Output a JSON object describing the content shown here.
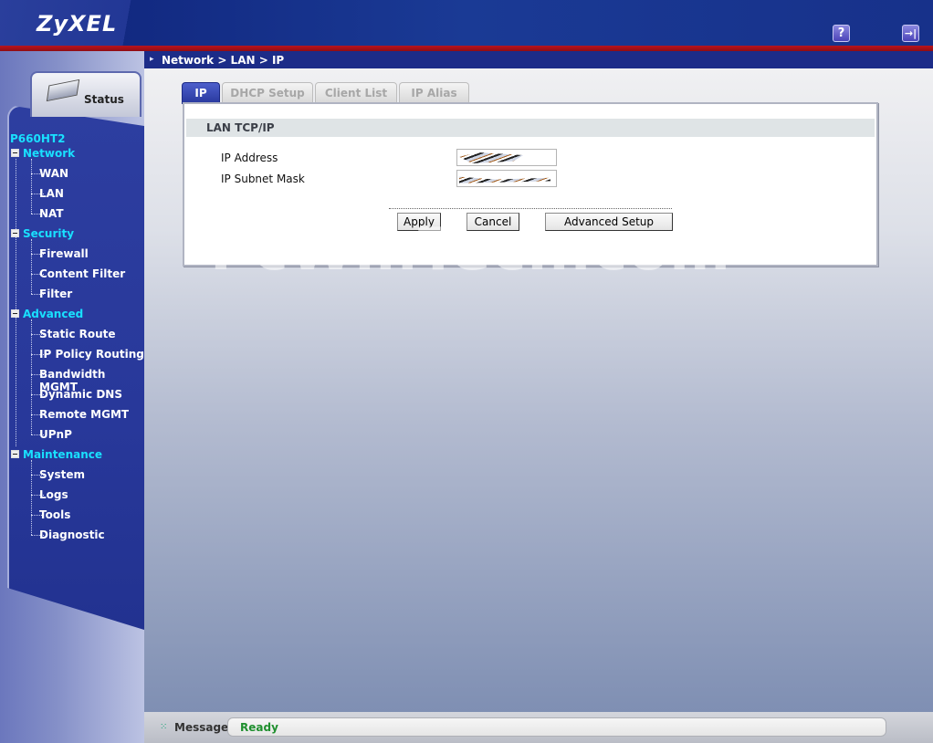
{
  "header": {
    "logo": "ZyXEL",
    "help_label": "?",
    "logout_label": "→|"
  },
  "breadcrumb": "Network > LAN > IP",
  "status_tab": {
    "label": "Status",
    "icon": "router-icon"
  },
  "sidebar": {
    "model": "P660HT2",
    "groups": [
      {
        "label": "Network",
        "items": [
          "WAN",
          "LAN",
          "NAT"
        ]
      },
      {
        "label": "Security",
        "items": [
          "Firewall",
          "Content Filter",
          "Filter"
        ]
      },
      {
        "label": "Advanced",
        "items": [
          "Static Route",
          "IP Policy Routing",
          "Bandwidth MGMT",
          "Dynamic DNS",
          "Remote MGMT",
          "UPnP"
        ]
      },
      {
        "label": "Maintenance",
        "items": [
          "System",
          "Logs",
          "Tools",
          "Diagnostic"
        ]
      }
    ]
  },
  "tabs": [
    {
      "label": "IP",
      "active": true
    },
    {
      "label": "DHCP Setup",
      "active": false
    },
    {
      "label": "Client List",
      "active": false
    },
    {
      "label": "IP Alias",
      "active": false
    }
  ],
  "panel": {
    "section_title": "LAN TCP/IP",
    "fields": [
      {
        "label": "IP Address",
        "value": ""
      },
      {
        "label": "IP Subnet Mask",
        "value": ""
      }
    ],
    "buttons": {
      "apply": "Apply",
      "cancel": "Cancel",
      "advanced": "Advanced Setup"
    }
  },
  "watermark": "PcWinTech.com",
  "message": {
    "label": "Message",
    "value": "Ready"
  },
  "colors": {
    "header_blue": "#1a3a95",
    "accent_red": "#b9141d",
    "nav_cyan": "#19e0ff",
    "status_green": "#1f8f2e"
  }
}
